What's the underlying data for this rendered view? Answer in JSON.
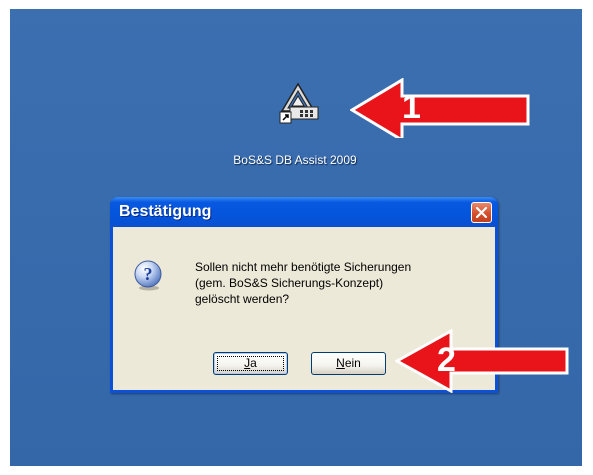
{
  "desktop": {
    "background": "#3a6ea5",
    "shortcut": {
      "label": "BoS&S DB Assist 2009",
      "icon": "bos-db-assist-app-icon"
    }
  },
  "dialog": {
    "title": "Bestätigung",
    "close_icon": "close-icon",
    "question_icon": "question-icon",
    "message_lines": [
      "Sollen nicht mehr benötigte Sicherungen",
      "(gem. BoS&S Sicherungs-Konzept)",
      "gelöscht werden?"
    ],
    "buttons": {
      "yes": {
        "mnemonic": "J",
        "rest": "a"
      },
      "no": {
        "mnemonic": "N",
        "rest": "ein"
      }
    }
  },
  "annotations": {
    "arrow_color": "#e8141a",
    "step1": "1",
    "step2": "2"
  }
}
